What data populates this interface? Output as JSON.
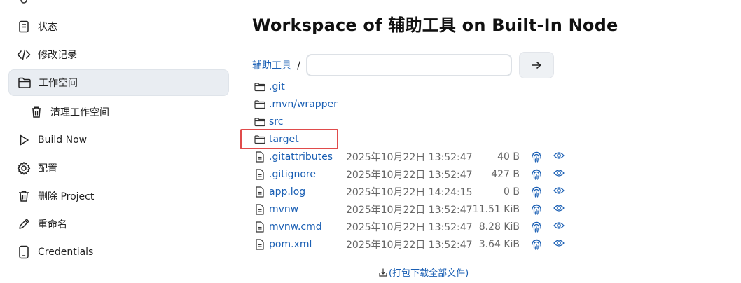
{
  "sidebar": {
    "items": [
      {
        "label": "状态",
        "icon": "document-icon"
      },
      {
        "label": "修改记录",
        "icon": "code-icon"
      },
      {
        "label": "工作空间",
        "icon": "folder-icon"
      },
      {
        "label": "清理工作空间",
        "icon": "trash-icon"
      },
      {
        "label": "Build Now",
        "icon": "play-icon"
      },
      {
        "label": "配置",
        "icon": "gear-icon"
      },
      {
        "label": "删除 Project",
        "icon": "trash-icon"
      },
      {
        "label": "重命名",
        "icon": "pencil-icon"
      },
      {
        "label": "Credentials",
        "icon": "phone-icon"
      }
    ]
  },
  "main": {
    "title": "Workspace of 辅助工具 on Built-In Node",
    "breadcrumb": {
      "root": "辅助工具",
      "separator": "/"
    },
    "path_input": {
      "value": "",
      "placeholder": ""
    },
    "folders": [
      {
        "name": ".git"
      },
      {
        "name": ".mvn/wrapper"
      },
      {
        "name": "src"
      },
      {
        "name": "target"
      }
    ],
    "files": [
      {
        "name": ".gitattributes",
        "date": "2025年10月22日 13:52:47",
        "size": "40 B"
      },
      {
        "name": ".gitignore",
        "date": "2025年10月22日 13:52:47",
        "size": "427 B"
      },
      {
        "name": "app.log",
        "date": "2025年10月22日 14:24:15",
        "size": "0 B"
      },
      {
        "name": "mvnw",
        "date": "2025年10月22日 13:52:47",
        "size": "11.51 KiB"
      },
      {
        "name": "mvnw.cmd",
        "date": "2025年10月22日 13:52:47",
        "size": "8.28 KiB"
      },
      {
        "name": "pom.xml",
        "date": "2025年10月22日 13:52:47",
        "size": "3.64 KiB"
      }
    ],
    "download_all": "(打包下载全部文件)"
  },
  "colors": {
    "link": "#1a5fb4",
    "highlight": "#e04b4b",
    "active_bg": "#e9edf2"
  }
}
